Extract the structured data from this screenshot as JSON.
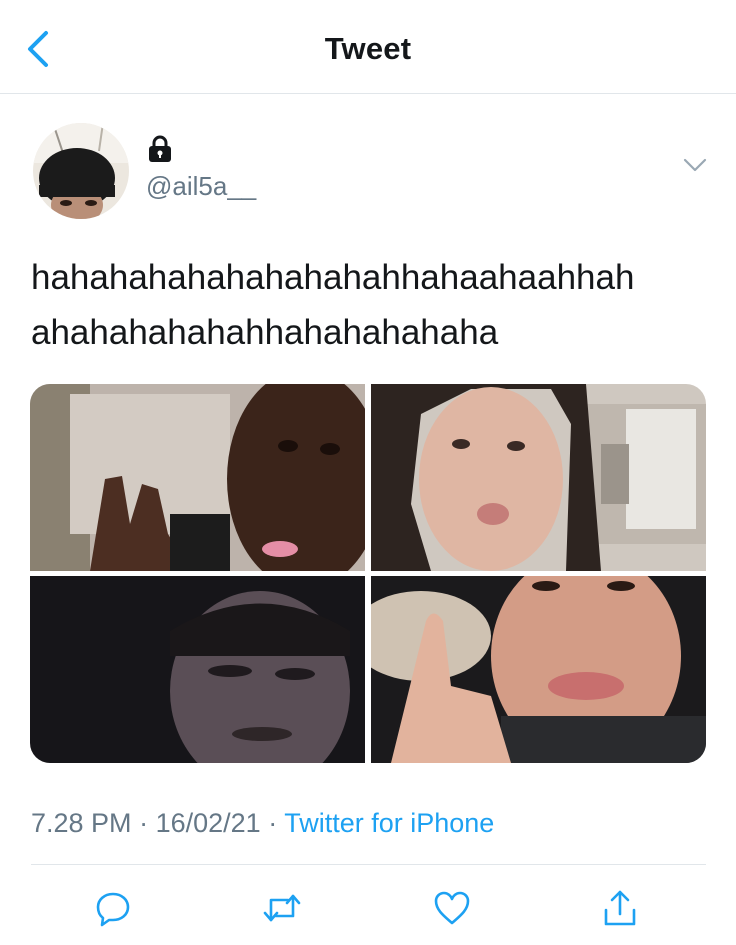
{
  "header": {
    "title": "Tweet",
    "back_icon": "chevron-left-icon"
  },
  "tweet": {
    "handle": "@ail5a__",
    "protected_icon": "lock-icon",
    "text_lines": [
      "hahahahahahahahahahhahaahaahhah",
      "ahahahahahahhahahahahaha"
    ],
    "photos": [
      "photo-1",
      "photo-2",
      "photo-3",
      "photo-4"
    ],
    "time": "7.28 PM",
    "separator": "·",
    "date": "16/02/21",
    "source": "Twitter for iPhone"
  },
  "actions": [
    {
      "name": "reply",
      "icon": "reply-icon"
    },
    {
      "name": "retweet",
      "icon": "retweet-icon"
    },
    {
      "name": "like",
      "icon": "heart-icon"
    },
    {
      "name": "share",
      "icon": "share-icon"
    }
  ],
  "colors": {
    "accent": "#1da1f2",
    "secondary_text": "#657786",
    "divider": "#e1e6ea"
  }
}
